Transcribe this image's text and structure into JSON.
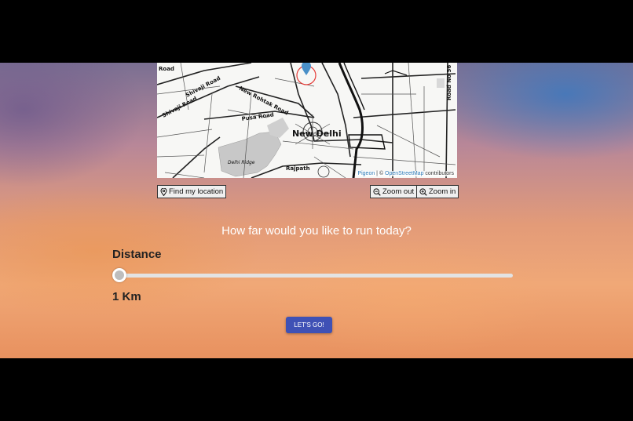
{
  "map": {
    "labels": {
      "road": "Road",
      "shivaji_road_1": "Shivaji Road",
      "shivaji_road_2": "Shivaji Road",
      "new_rohtak_road": "New Rohtak Road",
      "pusa_road": "Pusa Road",
      "new_delhi": "New Delhi",
      "delhi_ridge": "Delhi Ridge",
      "rajpath": "Rajpath",
      "road_no_56": "Road No 56"
    },
    "attribution": {
      "pigeon": "Pigeon",
      "separator": " | © ",
      "osm": "OpenStreetMap",
      "contributors": " contributors"
    }
  },
  "controls": {
    "find_location": "Find my location",
    "zoom_out": "Zoom out",
    "zoom_in": "Zoom in"
  },
  "main": {
    "question": "How far would you like to run today?",
    "distance_label": "Distance",
    "distance_value": "1 Km",
    "distance_fraction": 0.0,
    "go_button": "LET'S GO!"
  },
  "colors": {
    "go_button": "#3f51b5",
    "marker": "#4a90c8",
    "marker_ring": "#e53935"
  },
  "icons": {
    "find_location": "location-pin-icon",
    "zoom_out": "zoom-out-icon",
    "zoom_in": "zoom-in-icon"
  }
}
